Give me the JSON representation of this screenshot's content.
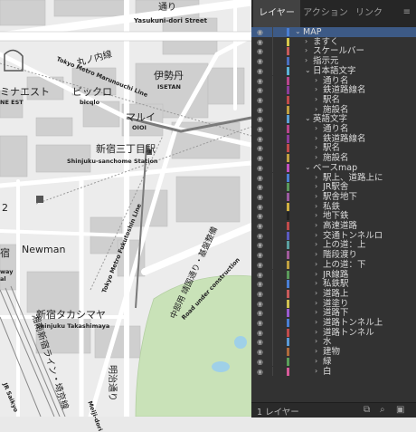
{
  "map": {
    "road_labels": [
      "通り",
      "Yasukuni-dori Street",
      "丸ノ内線",
      "Tokyo Metro Marunouchi Line",
      "Tokyo Metro Fukutoshin Line",
      "明治通り",
      "Meiji-dori",
      "中部用 靖国通り・基盤整備",
      "Road under construction",
      "湘南新宿ライン・埼京線",
      "JR Saikyo"
    ],
    "place_labels": [
      {
        "jp": "伊勢丹",
        "en": "ISETAN"
      },
      {
        "jp": "ビックロ",
        "en": "bicqlo"
      },
      {
        "jp": "マルイ",
        "en": "OIOI"
      },
      {
        "jp": "新宿三丁目駅",
        "en": "Shinjuku-sanchome Station"
      },
      {
        "jp": "新宿タカシマヤ",
        "en": "Shinjuku Takashimaya"
      },
      {
        "jp": "ミナエスト",
        "en": "NE EST"
      },
      {
        "jp": "Newman",
        "en": ""
      },
      {
        "jp": "宿",
        "en": ""
      }
    ],
    "misc_labels": [
      "2",
      "way",
      "al"
    ]
  },
  "panel": {
    "tabs": [
      "レイヤー",
      "アクション",
      "リンク"
    ],
    "active_tab": 0,
    "layers": [
      {
        "label": "MAP",
        "depth": 0,
        "expanded": true,
        "color": "#4a7fd4",
        "selected": true
      },
      {
        "label": "ますく",
        "depth": 1,
        "expanded": false,
        "color": "#d7c84a"
      },
      {
        "label": "スケールバー",
        "depth": 1,
        "expanded": false,
        "color": "#c85a5a"
      },
      {
        "label": "指示元",
        "depth": 1,
        "expanded": false,
        "color": "#4a6fc0"
      },
      {
        "label": "日本語文字",
        "depth": 1,
        "expanded": true,
        "color": "#5ab3d6"
      },
      {
        "label": "通り名",
        "depth": 2,
        "expanded": false,
        "color": "#b8458c"
      },
      {
        "label": "鉄道路線名",
        "depth": 2,
        "expanded": false,
        "color": "#8c3c9a"
      },
      {
        "label": "駅名",
        "depth": 2,
        "expanded": false,
        "color": "#c24a4a"
      },
      {
        "label": "施設名",
        "depth": 2,
        "expanded": false,
        "color": "#c0a040"
      },
      {
        "label": "英語文字",
        "depth": 1,
        "expanded": true,
        "color": "#5aa0d6"
      },
      {
        "label": "通り名",
        "depth": 2,
        "expanded": false,
        "color": "#b8458c"
      },
      {
        "label": "鉄道路線名",
        "depth": 2,
        "expanded": false,
        "color": "#8c3c9a"
      },
      {
        "label": "駅名",
        "depth": 2,
        "expanded": false,
        "color": "#c24a4a"
      },
      {
        "label": "施設名",
        "depth": 2,
        "expanded": false,
        "color": "#c0a040"
      },
      {
        "label": "ベースmap",
        "depth": 1,
        "expanded": true,
        "color": "#c050c0"
      },
      {
        "label": "駅上、道路上に",
        "depth": 2,
        "expanded": false,
        "color": "#4a7fd4"
      },
      {
        "label": "JR駅舎",
        "depth": 2,
        "expanded": false,
        "color": "#5a9a5a"
      },
      {
        "label": "駅舎地下",
        "depth": 2,
        "expanded": false,
        "color": "#9a5aa0"
      },
      {
        "label": "私鉄",
        "depth": 2,
        "expanded": false,
        "color": "#d0b040"
      },
      {
        "label": "地下鉄",
        "depth": 2,
        "expanded": false,
        "color": "#222222"
      },
      {
        "label": "高速道路",
        "depth": 2,
        "expanded": false,
        "color": "#c04a4a"
      },
      {
        "label": "交通トンネルロ",
        "depth": 2,
        "expanded": false,
        "color": "#5a5ac0"
      },
      {
        "label": "上の道：上",
        "depth": 2,
        "expanded": false,
        "color": "#5aa0a0"
      },
      {
        "label": "階段渡り",
        "depth": 2,
        "expanded": false,
        "color": "#a05a9a"
      },
      {
        "label": "上の道：下",
        "depth": 2,
        "expanded": false,
        "color": "#c0a040"
      },
      {
        "label": "JR線路",
        "depth": 2,
        "expanded": false,
        "color": "#5a9a5a"
      },
      {
        "label": "私鉄駅",
        "depth": 2,
        "expanded": false,
        "color": "#4a7fd4"
      },
      {
        "label": "道路上",
        "depth": 2,
        "expanded": false,
        "color": "#c85a5a"
      },
      {
        "label": "道塗り",
        "depth": 2,
        "expanded": false,
        "color": "#d0c050"
      },
      {
        "label": "道路下",
        "depth": 2,
        "expanded": false,
        "color": "#9a5ad0"
      },
      {
        "label": "道路トンネル上",
        "depth": 2,
        "expanded": false,
        "color": "#4a7fd4"
      },
      {
        "label": "道路トンネル",
        "depth": 2,
        "expanded": false,
        "color": "#c04a4a"
      },
      {
        "label": "水",
        "depth": 2,
        "expanded": false,
        "color": "#5a9ad6"
      },
      {
        "label": "建物",
        "depth": 2,
        "expanded": false,
        "color": "#b06a3a"
      },
      {
        "label": "緑",
        "depth": 2,
        "expanded": false,
        "color": "#5aa05a"
      },
      {
        "label": "白",
        "depth": 2,
        "expanded": false,
        "color": "#d85a9a"
      }
    ],
    "footer_label": "1 レイヤー"
  }
}
